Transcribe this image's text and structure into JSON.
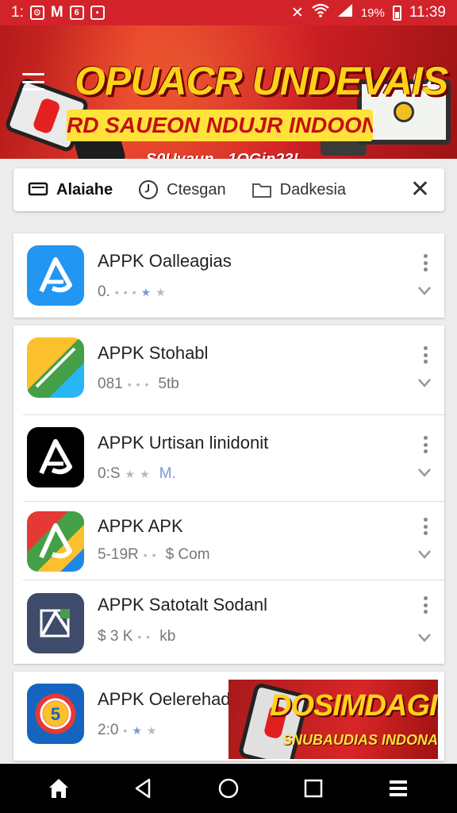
{
  "status_bar": {
    "left_text": "1:",
    "icons": [
      "notification-icon",
      "mail-icon",
      "app-icon",
      "app-icon"
    ],
    "battery_text": "19%",
    "time": "11:39"
  },
  "banner": {
    "title": "OPUACR UNDEVAIS",
    "subtitle": "RD SAUEON NDUJR INDOONCA",
    "date_text": "S0Uyaun - 1OGin23!"
  },
  "filters": [
    {
      "label": "Alaiahe",
      "icon": "tv-icon",
      "active": true
    },
    {
      "label": "Ctesgan",
      "icon": "clock-icon",
      "active": false
    },
    {
      "label": "Dadkesia",
      "icon": "folder-icon",
      "active": false
    }
  ],
  "apps": [
    {
      "name": "APPK Oalleagias",
      "meta": "0.",
      "icon": "app-logo-blue-icon",
      "icon_bg": "#2196f3"
    },
    {
      "name": "APPK Stohabl",
      "meta": "081",
      "meta2": "5tb",
      "icon": "app-logo-green-yellow-icon",
      "icon_bg": "#43a047"
    },
    {
      "name": "APPK Urtisan linidonit",
      "meta": "0:S",
      "meta2": "M.",
      "icon": "app-logo-black-icon",
      "icon_bg": "#000000"
    },
    {
      "name": "APPK APK",
      "meta": "5-19R",
      "meta2": "$ Com",
      "icon": "app-logo-multicolor-icon",
      "icon_bg": "#e53935"
    },
    {
      "name": "APPK Satotalt Sodanl",
      "meta": "$ 3 K",
      "meta2": "kb",
      "icon": "app-logo-slate-icon",
      "icon_bg": "#3f4b6b"
    },
    {
      "name": "APPK Oelerehadie",
      "meta": "2:0",
      "icon": "app-logo-circle-icon",
      "icon_bg": "#1565c0"
    }
  ],
  "promo": {
    "title": "DOSIMDAGI?",
    "subtitle": "SNUBAUDIAS INDONASIS"
  },
  "nav": [
    "home-icon",
    "back-icon",
    "circle-home-icon",
    "recents-icon",
    "menu-icon"
  ],
  "colors": {
    "accent": "#d3232a",
    "banner_yellow": "#ffd21a"
  }
}
